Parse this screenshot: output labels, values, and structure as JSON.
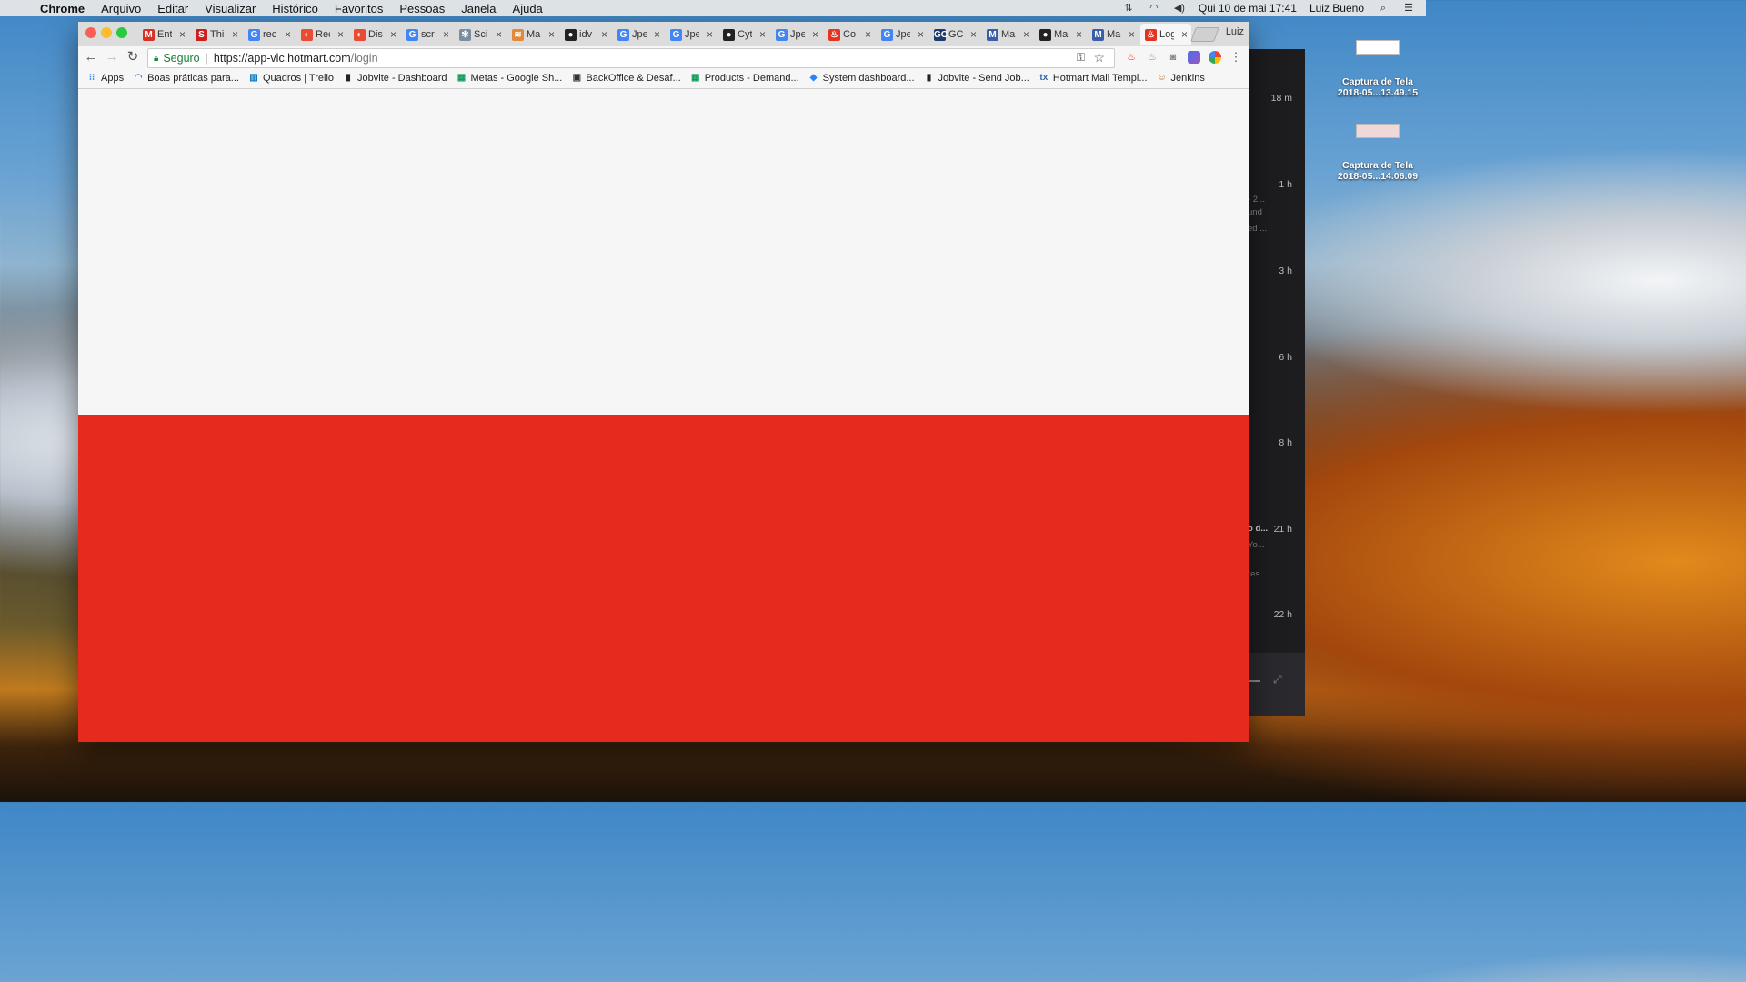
{
  "menubar": {
    "app_name": "Chrome",
    "items": [
      "Arquivo",
      "Editar",
      "Visualizar",
      "Histórico",
      "Favoritos",
      "Pessoas",
      "Janela",
      "Ajuda"
    ],
    "datetime": "Qui 10 de mai  17:41",
    "user": "Luiz Bueno"
  },
  "desktop": {
    "files": [
      {
        "line1": "Captura de Tela",
        "line2": "2018-05...13.49.15"
      },
      {
        "line1": "Captura de Tela",
        "line2": "2018-05...14.06.09"
      }
    ]
  },
  "bg_panel": {
    "times": [
      "18 m",
      "1 h",
      "3 h",
      "6 h",
      "8 h",
      "21 h",
      "22 h"
    ],
    "snippets": [
      "- 2...",
      "und",
      "ed ...",
      "o d...",
      "Yo...",
      "res"
    ]
  },
  "tabs": [
    {
      "label": "Ent",
      "icon": "gmail-icon",
      "color": "#d93025",
      "glyph": "M"
    },
    {
      "label": "Thi",
      "icon": "s-logo-icon",
      "color": "#cc1f1f",
      "glyph": "S"
    },
    {
      "label": "rec",
      "icon": "google-icon",
      "color": "#4285f4",
      "glyph": "G"
    },
    {
      "label": "Rec",
      "icon": "circle-logo-icon",
      "color": "#e94b35",
      "glyph": "◐"
    },
    {
      "label": "Dis",
      "icon": "circle-logo-icon",
      "color": "#e94b35",
      "glyph": "◐"
    },
    {
      "label": "scr",
      "icon": "google-icon",
      "color": "#4285f4",
      "glyph": "G"
    },
    {
      "label": "Sci",
      "icon": "atom-icon",
      "color": "#7a8ea0",
      "glyph": "✻"
    },
    {
      "label": "Ma",
      "icon": "stack-icon",
      "color": "#e08a3a",
      "glyph": "≋"
    },
    {
      "label": "idv",
      "icon": "github-icon",
      "color": "#222222",
      "glyph": "●"
    },
    {
      "label": "Jpe",
      "icon": "google-icon",
      "color": "#4285f4",
      "glyph": "G"
    },
    {
      "label": "Jpe",
      "icon": "google-icon",
      "color": "#4285f4",
      "glyph": "G"
    },
    {
      "label": "Cyt",
      "icon": "github-icon",
      "color": "#222222",
      "glyph": "●"
    },
    {
      "label": "Jpe",
      "icon": "google-icon",
      "color": "#4285f4",
      "glyph": "G"
    },
    {
      "label": "Co",
      "icon": "hotmart-icon",
      "color": "#e6331f",
      "glyph": "♨"
    },
    {
      "label": "Jpe",
      "icon": "google-icon",
      "color": "#4285f4",
      "glyph": "G"
    },
    {
      "label": "GC",
      "icon": "gc-icon",
      "color": "#1c3b6e",
      "glyph": "GC"
    },
    {
      "label": "Ma",
      "icon": "mvn-icon",
      "color": "#3a5ea8",
      "glyph": "M"
    },
    {
      "label": "Ma",
      "icon": "github-icon",
      "color": "#222222",
      "glyph": "●"
    },
    {
      "label": "Ma",
      "icon": "mvn-icon",
      "color": "#3a5ea8",
      "glyph": "M"
    },
    {
      "label": "Log",
      "icon": "hotmart-icon",
      "color": "#e6331f",
      "glyph": "♨",
      "active": true
    }
  ],
  "profile_name": "Luiz",
  "address": {
    "secure_label": "Seguro",
    "host": "https://app-vlc.hotmart.com",
    "path": "/login"
  },
  "bookmarks": [
    {
      "label": "Apps",
      "icon": "apps-grid-icon",
      "color": "#4285f4",
      "glyph": "⁝⁝"
    },
    {
      "label": "Boas práticas para...",
      "icon": "spinner-icon",
      "color": "#3a7bd5",
      "glyph": "◠"
    },
    {
      "label": "Quadros | Trello",
      "icon": "trello-icon",
      "color": "#0079bf",
      "glyph": "▥"
    },
    {
      "label": "Jobvite - Dashboard",
      "icon": "jobvite-icon",
      "color": "#222222",
      "glyph": "▮"
    },
    {
      "label": "Metas - Google Sh...",
      "icon": "sheets-icon",
      "color": "#0f9d58",
      "glyph": "▦"
    },
    {
      "label": "BackOffice & Desaf...",
      "icon": "board-icon",
      "color": "#333333",
      "glyph": "▣"
    },
    {
      "label": "Products - Demand...",
      "icon": "sheets-icon",
      "color": "#0f9d58",
      "glyph": "▦"
    },
    {
      "label": "System dashboard...",
      "icon": "jira-icon",
      "color": "#2684ff",
      "glyph": "◆"
    },
    {
      "label": "Jobvite - Send Job...",
      "icon": "jobvite-icon",
      "color": "#222222",
      "glyph": "▮"
    },
    {
      "label": "Hotmart Mail Templ...",
      "icon": "tx-icon",
      "color": "#2b6aa8",
      "glyph": "tx"
    },
    {
      "label": "Jenkins",
      "icon": "jenkins-icon",
      "color": "#b5651d",
      "glyph": "☺"
    }
  ],
  "colors": {
    "page_top": "#f6f6f6",
    "page_bottom": "#e62b1e"
  }
}
